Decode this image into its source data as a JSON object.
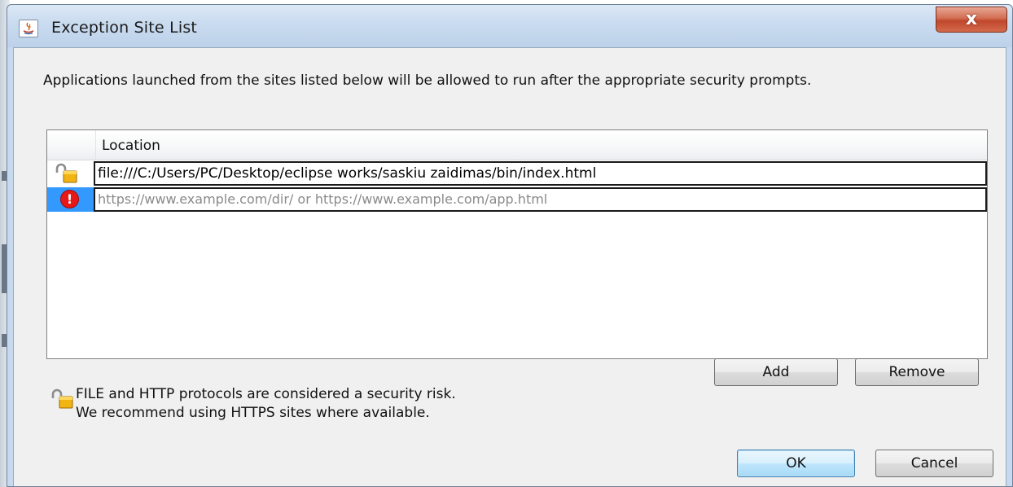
{
  "window": {
    "title": "Exception Site List",
    "close_label": "x"
  },
  "description": "Applications launched from the sites listed below will be allowed to run after the appropriate security prompts.",
  "table": {
    "column_header": "Location",
    "rows": [
      {
        "icon": "unlocked-padlock-icon",
        "value": "file:///C:/Users/PC/Desktop/eclipse works/saskiu zaidimas/bin/index.html"
      },
      {
        "icon": "error-icon",
        "placeholder": "https://www.example.com/dir/ or https://www.example.com/app.html"
      }
    ]
  },
  "buttons": {
    "add": "Add",
    "remove": "Remove",
    "ok": "OK",
    "cancel": "Cancel"
  },
  "warning": {
    "icon": "unlocked-padlock-icon",
    "line1": "FILE and HTTP protocols are considered a security risk.",
    "line2": "We recommend using HTTPS sites where available."
  },
  "colors": {
    "selection": "#3399ff",
    "error": "#e81818",
    "close_button": "#c0472c"
  }
}
